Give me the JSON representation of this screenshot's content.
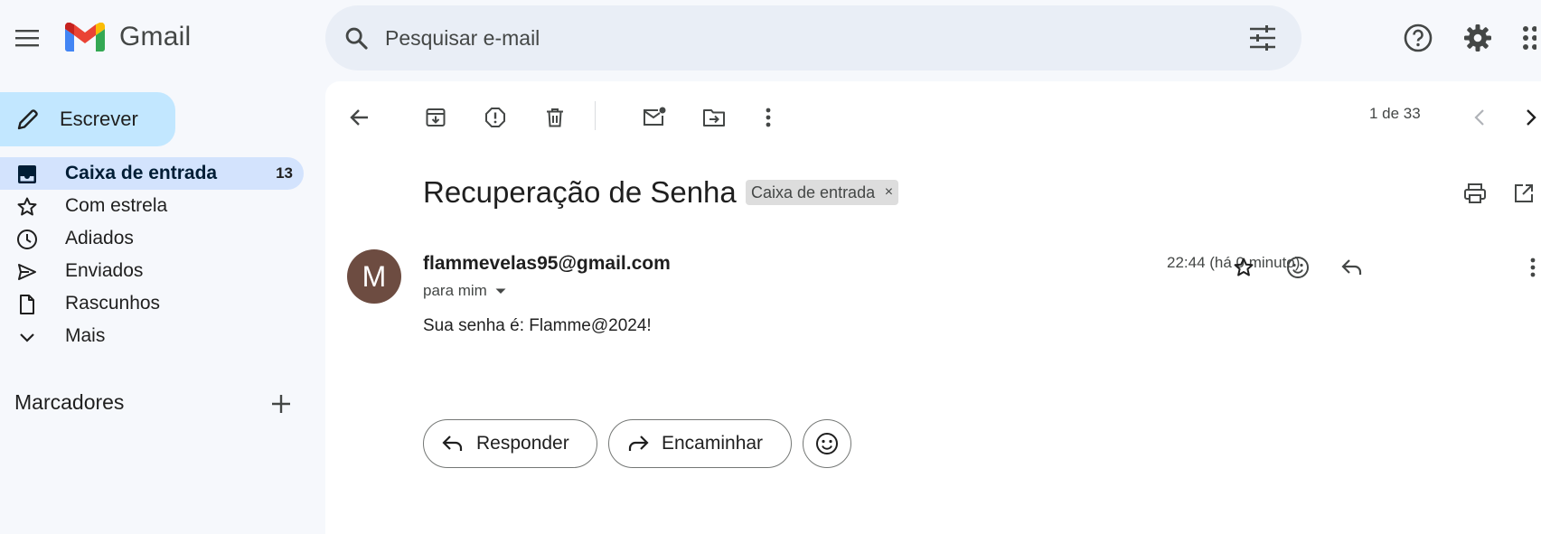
{
  "app": {
    "name": "Gmail",
    "search_placeholder": "Pesquisar e-mail"
  },
  "compose": {
    "label": "Escrever"
  },
  "sidebar": {
    "items": [
      {
        "label": "Caixa de entrada",
        "count": "13",
        "icon": "inbox-icon",
        "active": true
      },
      {
        "label": "Com estrela",
        "icon": "star-icon"
      },
      {
        "label": "Adiados",
        "icon": "clock-icon"
      },
      {
        "label": "Enviados",
        "icon": "send-icon"
      },
      {
        "label": "Rascunhos",
        "icon": "draft-icon"
      },
      {
        "label": "Mais",
        "icon": "chevron-down-icon"
      }
    ],
    "labels_heading": "Marcadores"
  },
  "toolbar": {
    "pager": "1 de 33"
  },
  "message": {
    "subject": "Recuperação de Senha",
    "label_chip": "Caixa de entrada",
    "chip_close": "×",
    "avatar_letter": "M",
    "avatar_color": "#6d4c41",
    "sender": "flammevelas95@gmail.com",
    "recipient": "para mim",
    "time": "22:44 (há 0 minuto)",
    "body": "Sua senha é: Flamme@2024!"
  },
  "actions": {
    "reply": "Responder",
    "forward": "Encaminhar"
  },
  "colors": {
    "background": "#f6f8fc",
    "compose": "#c2e7ff",
    "active_nav": "#d3e3fd",
    "search": "#e9eef6"
  }
}
